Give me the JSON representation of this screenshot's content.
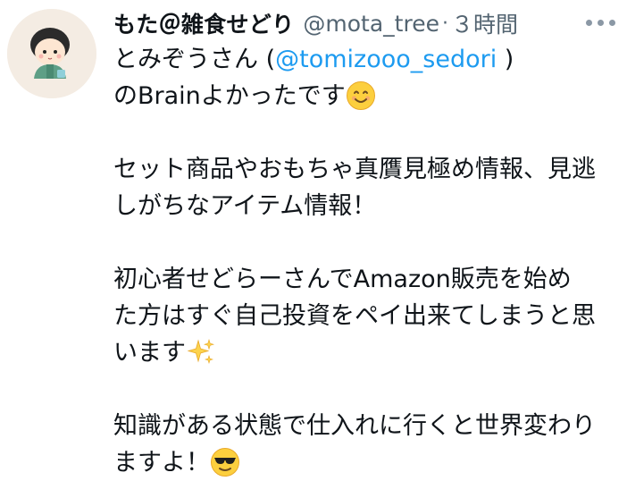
{
  "author": {
    "display_name": "もた＠雑食せどり",
    "handle": "@mota_tree",
    "separator": "·",
    "time": "３時間"
  },
  "tweet": {
    "line1_text": "とみぞうさん (",
    "mention": "@tomizooo_sedori",
    "line1_suffix": " )",
    "line2_text": "のBrainよかったです",
    "line2_emoji": "smiling-face-icon",
    "line3": "セット商品やおもちゃ真贋見極め情報、見逃",
    "line4": "しがちなアイテム情報！",
    "line5": "初心者せどらーさんでAmazon販売を始め",
    "line6": "た方はすぐ自己投資をペイ出来てしまうと思",
    "line7_text": "います",
    "line7_emoji": "sparkles-icon",
    "line8": "知識がある状態で仕入れに行くと世界変わり",
    "line9_text": "ますよ！",
    "line9_emoji": "sunglasses-face-icon"
  },
  "colors": {
    "text": "#0f1419",
    "secondary": "#536471",
    "link": "#1d9bf0"
  },
  "icons": {
    "more": "more-horizontal-icon",
    "avatar": "avatar"
  }
}
